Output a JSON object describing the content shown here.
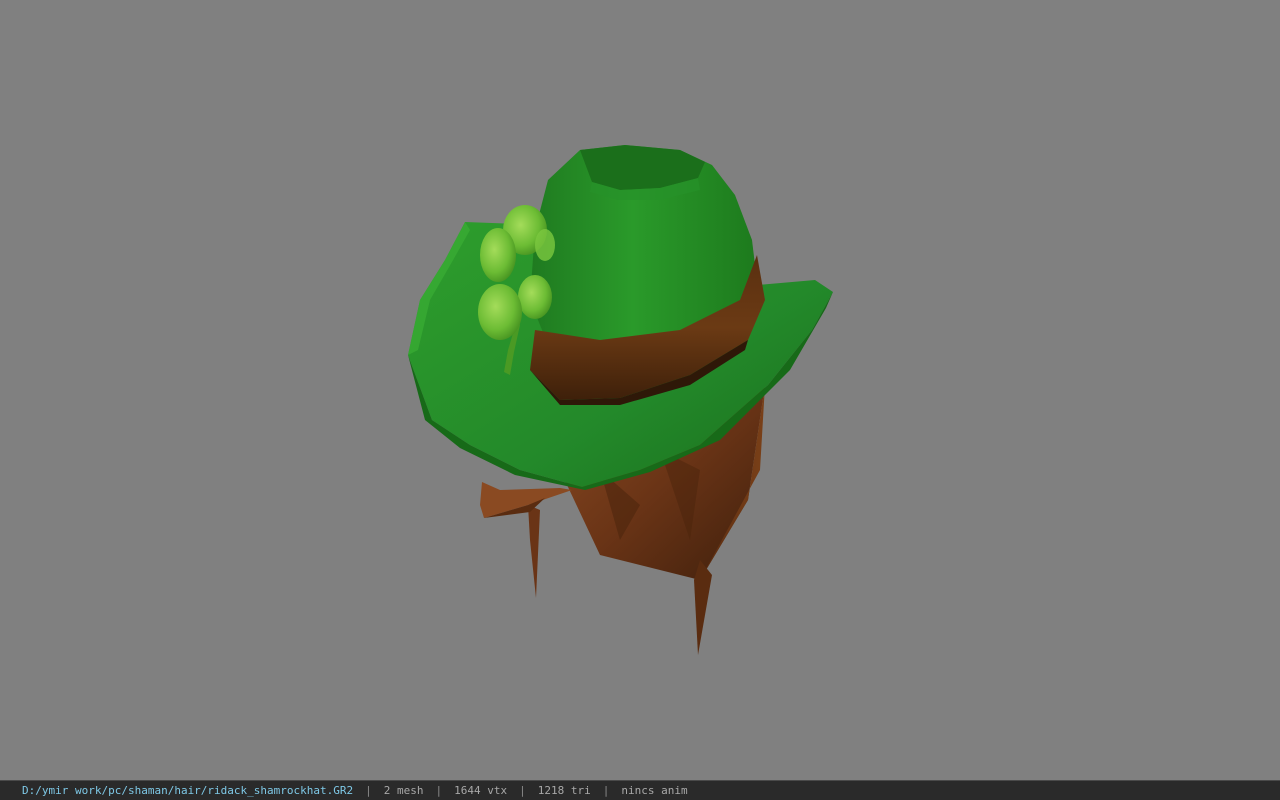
{
  "viewer": {
    "background_color": "#808080",
    "model_name": "shamrock-hat"
  },
  "statusbar": {
    "path": "D:/ymir work/pc/shaman/hair/ridack_shamrockhat.GR2",
    "separator": "|",
    "mesh": "2 mesh",
    "vertices": "1644 vtx",
    "triangles": "1218 tri",
    "anim": "nincs anim"
  }
}
